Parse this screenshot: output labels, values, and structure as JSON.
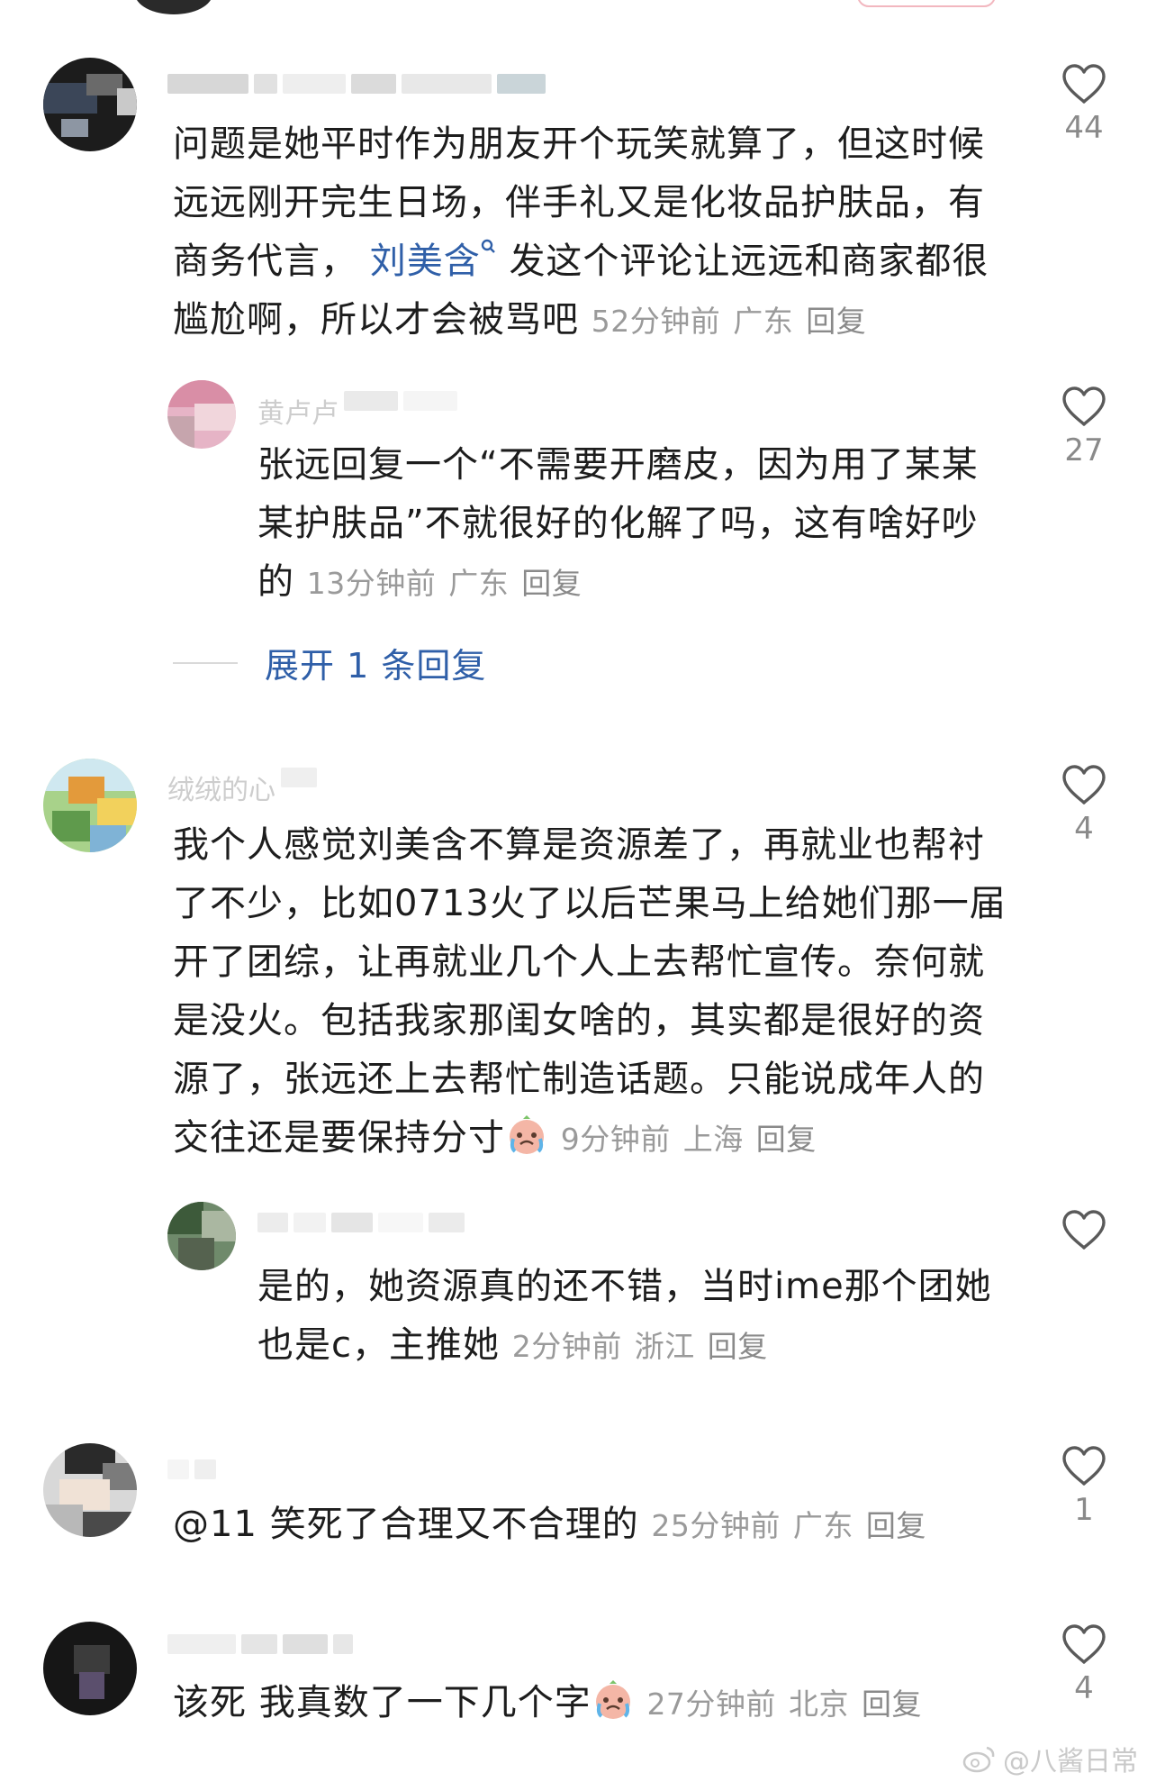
{
  "comments": [
    {
      "body": "问题是她平时作为朋友开个玩笑就算了，但这时候远远刚开完生日场，伴手礼又是化妆品护肤品，有商务代言，",
      "mention": "刘美含",
      "body_after": "发这个评论让远远和商家都很尴尬啊，所以才会被骂吧",
      "time": "52分钟前",
      "location": "广东",
      "reply_label": "回复",
      "likes": "44"
    },
    {
      "username": "黄卢卢",
      "body": "张远回复一个“不需要开磨皮，因为用了某某某护肤品”不就很好的化解了吗，这有啥好吵的",
      "time": "13分钟前",
      "location": "广东",
      "reply_label": "回复",
      "likes": "27"
    },
    {
      "expand_label": "展开 1 条回复"
    },
    {
      "username": "绒绒的心",
      "body": "我个人感觉刘美含不算是资源差了，再就业也帮衬了不少，比如0713火了以后芒果马上给她们那一届开了团综，让再就业几个人上去帮忙宣传。奈何就是没火。包括我家那闺女啥的，其实都是很好的资源了，张远还上去帮忙制造话题。只能说成年人的交往还是要保持分寸",
      "time": "9分钟前",
      "location": "上海",
      "reply_label": "回复",
      "likes": "4"
    },
    {
      "body": "是的，她资源真的还不错，当时ime那个团她也是c，主推她",
      "time": "2分钟前",
      "location": "浙江",
      "reply_label": "回复",
      "likes": ""
    },
    {
      "body": "@11 笑死了合理又不合理的",
      "time": "25分钟前",
      "location": "广东",
      "reply_label": "回复",
      "likes": "1"
    },
    {
      "body": "该死  我真数了一下几个字",
      "time": "27分钟前",
      "location": "北京",
      "reply_label": "回复",
      "likes": "4"
    }
  ],
  "watermark": "@八酱日常",
  "colors": {
    "mention": "#2f5fa8",
    "meta": "#9a9a9a",
    "heart": "#5a5a5a"
  },
  "icons": {
    "like": "heart-outline-icon",
    "search": "search-icon",
    "emoji": "crying-emoji-icon",
    "weibo": "weibo-logo-icon"
  }
}
